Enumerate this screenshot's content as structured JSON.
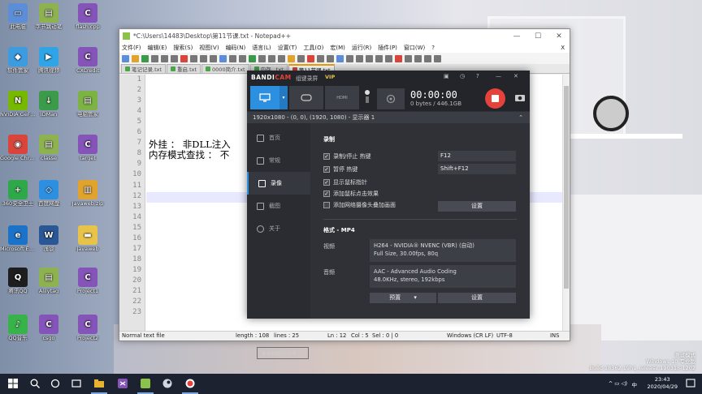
{
  "desktop": {
    "icons": [
      {
        "label": "此电脑",
        "color": "#5b8ed6",
        "glyph": "▭"
      },
      {
        "label": "字节跳动笔",
        "color": "#8db24f",
        "glyph": "▤"
      },
      {
        "label": "flash.cpp",
        "color": "#8454b8",
        "glyph": "C"
      },
      {
        "label": "软件管家",
        "color": "#3d9be0",
        "glyph": "◆"
      },
      {
        "label": "腾讯视频",
        "color": "#2fa4e7",
        "glyph": "▶"
      },
      {
        "label": "CXCredit",
        "color": "#8454b8",
        "glyph": "C"
      },
      {
        "label": "NVIDIA GeForce",
        "color": "#76b900",
        "glyph": "N"
      },
      {
        "label": "IDMan",
        "color": "#3b9b4a",
        "glyph": "↓"
      },
      {
        "label": "电脑管家",
        "color": "#7cb342",
        "glyph": "▤"
      },
      {
        "label": "Google Chrome",
        "color": "#d9453b",
        "glyph": "◉"
      },
      {
        "label": "classe",
        "color": "#8db24f",
        "glyph": "▤"
      },
      {
        "label": "target",
        "color": "#8454b8",
        "glyph": "C"
      },
      {
        "label": "360安全卫士",
        "color": "#2fa84a",
        "glyph": "+"
      },
      {
        "label": "百度网盘",
        "color": "#2d8fe0",
        "glyph": "◇"
      },
      {
        "label": "Javaweb.zip",
        "color": "#e0a32d",
        "glyph": "▥"
      },
      {
        "label": "Microsoft Edge",
        "color": "#1a73c9",
        "glyph": "e"
      },
      {
        "label": "浅谈",
        "color": "#2b5797",
        "glyph": "W"
      },
      {
        "label": "javaweb",
        "color": "#e8c34a",
        "glyph": "▬"
      },
      {
        "label": "腾讯QQ",
        "color": "#1e1e1e",
        "glyph": "Q"
      },
      {
        "label": "Alilytag",
        "color": "#8db24f",
        "glyph": "▤"
      },
      {
        "label": "Project1",
        "color": "#8454b8",
        "glyph": "C"
      },
      {
        "label": "QQ音乐",
        "color": "#37b34a",
        "glyph": "♪"
      },
      {
        "label": "csgo",
        "color": "#8454b8",
        "glyph": "C"
      },
      {
        "label": "Project2",
        "color": "#8454b8",
        "glyph": "C"
      }
    ]
  },
  "notepad": {
    "title": "*C:\\Users\\14483\\Desktop\\第11节课.txt - Notepad++",
    "window_controls": [
      "—",
      "☐",
      "✕"
    ],
    "menu": [
      "文件(F)",
      "编辑(E)",
      "搜索(S)",
      "视图(V)",
      "编码(N)",
      "语言(L)",
      "设置(T)",
      "工具(O)",
      "宏(M)",
      "运行(R)",
      "插件(P)",
      "窗口(W)",
      "?"
    ],
    "close_x": "X",
    "tabs": [
      {
        "label": "笔记记录.txt",
        "active": false
      },
      {
        "label": "重启.txt",
        "active": false
      },
      {
        "label": "0000简介.txt",
        "active": false
      },
      {
        "label": "内存...txt",
        "active": false
      },
      {
        "label": "第11节课.txt",
        "active": true
      }
    ],
    "line_numbers": [
      "1",
      "2",
      "3",
      "4",
      "5",
      "6",
      "7",
      "8",
      "9",
      "10",
      "11",
      "12",
      "13",
      "14",
      "15",
      "16",
      "17",
      "18",
      "19",
      "20",
      "21",
      "22",
      "23"
    ],
    "lines": [
      {
        "n": 7,
        "text": "外挂 ： 非DLL注入"
      },
      {
        "n": 8,
        "text": "内存模式查找 ： 不"
      }
    ],
    "status": {
      "type": "Normal text file",
      "length": "length : 108",
      "lines": "lines : 25",
      "pos": "Ln : 12",
      "col": "Col : 5",
      "sel": "Sel : 0 | 0",
      "eol": "Windows (CR LF)",
      "enc": "UTF-8",
      "ins": "INS"
    }
  },
  "bandicam": {
    "brand_a": "BANDI",
    "brand_b": "CAM",
    "ctrl_label": "组键录屏",
    "vip": "VIP",
    "header_icons": [
      "▣",
      "◷",
      "?",
      "—",
      "✕"
    ],
    "mode_hdmi": "HDMI",
    "timer": "00:00:00",
    "size": "0 bytes / 446.1GB",
    "info_bar": "1920x1080 - (0, 0), (1920, 1080) - 显示器 1",
    "nav": [
      {
        "label": "首页",
        "active": false
      },
      {
        "label": "常规",
        "active": false
      },
      {
        "label": "录像",
        "active": true
      },
      {
        "label": "截图",
        "active": false
      },
      {
        "label": "关于",
        "active": false
      }
    ],
    "bandicut": "BANDICUT ↗",
    "record_section": "录制",
    "checks": [
      {
        "label": "录制/停止 热键",
        "checked": true
      },
      {
        "label": "暂停 热键",
        "checked": true
      },
      {
        "label": "显示鼠标指针",
        "checked": true
      },
      {
        "label": "添加鼠标点击效果",
        "checked": true
      },
      {
        "label": "添加网络摄像头叠加画面",
        "checked": false
      }
    ],
    "hotkeys": [
      "F12",
      "Shift+F12"
    ],
    "settings_label": "设置",
    "format_section": "格式 - MP4",
    "video_label": "视频",
    "video_line1": "H264 - NVIDIA® NVENC (VBR) (自动)",
    "video_line2": "Full Size, 30.00fps, 80q",
    "audio_label": "音频",
    "audio_line1": "AAC - Advanced Audio Coding",
    "audio_line2": "48.0KHz, stereo, 192kbps",
    "preset_label": "预置",
    "settings2_label": "设置"
  },
  "taskbar": {
    "time": "23:43",
    "date": "2020/04/29",
    "lang": "中",
    "tray": "^ ▭ ◁)"
  },
  "watermark": {
    "line1": "测试模式",
    "line2": "Windows 10 专业版",
    "line3": "Build 18362.19h1_release.190318-1202"
  }
}
